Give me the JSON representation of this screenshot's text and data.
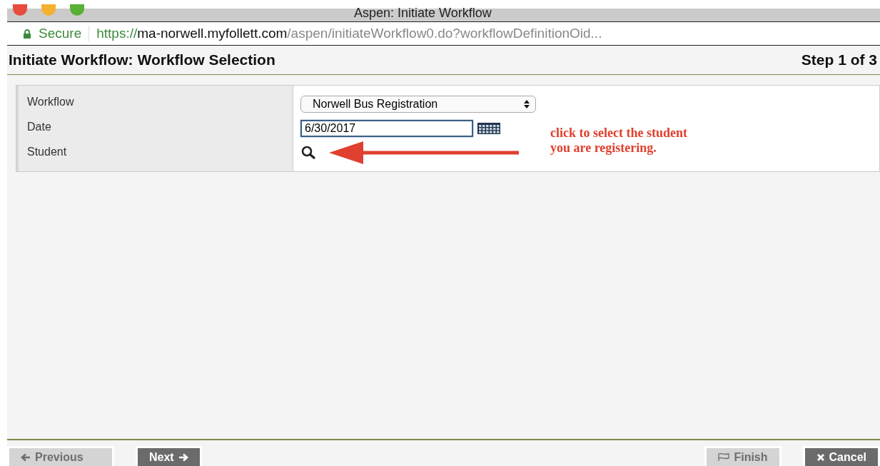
{
  "window": {
    "title": "Aspen: Initiate Workflow"
  },
  "address_bar": {
    "security_label": "Secure",
    "url_scheme": "https://",
    "url_host": "ma-norwell.myfollett.com",
    "url_path": "/aspen/initiateWorkflow0.do?workflowDefinitionOid..."
  },
  "header": {
    "title": "Initiate Workflow: Workflow Selection",
    "step": "Step 1 of 3"
  },
  "form": {
    "rows": [
      {
        "kind": "select",
        "label": "Workflow",
        "value": "Norwell Bus Registration"
      },
      {
        "kind": "date",
        "label": "Date",
        "value": "6/30/2017"
      },
      {
        "kind": "lookup",
        "label": "Student"
      }
    ]
  },
  "annotation": {
    "text": "click to select the student you are registering."
  },
  "buttons": [
    {
      "kind": "previous",
      "label": "Previous",
      "disabled": true
    },
    {
      "kind": "next",
      "label": "Next",
      "disabled": false
    },
    {
      "kind": "finish",
      "label": "Finish",
      "disabled": true
    },
    {
      "kind": "cancel",
      "label": "Cancel",
      "disabled": false
    }
  ]
}
